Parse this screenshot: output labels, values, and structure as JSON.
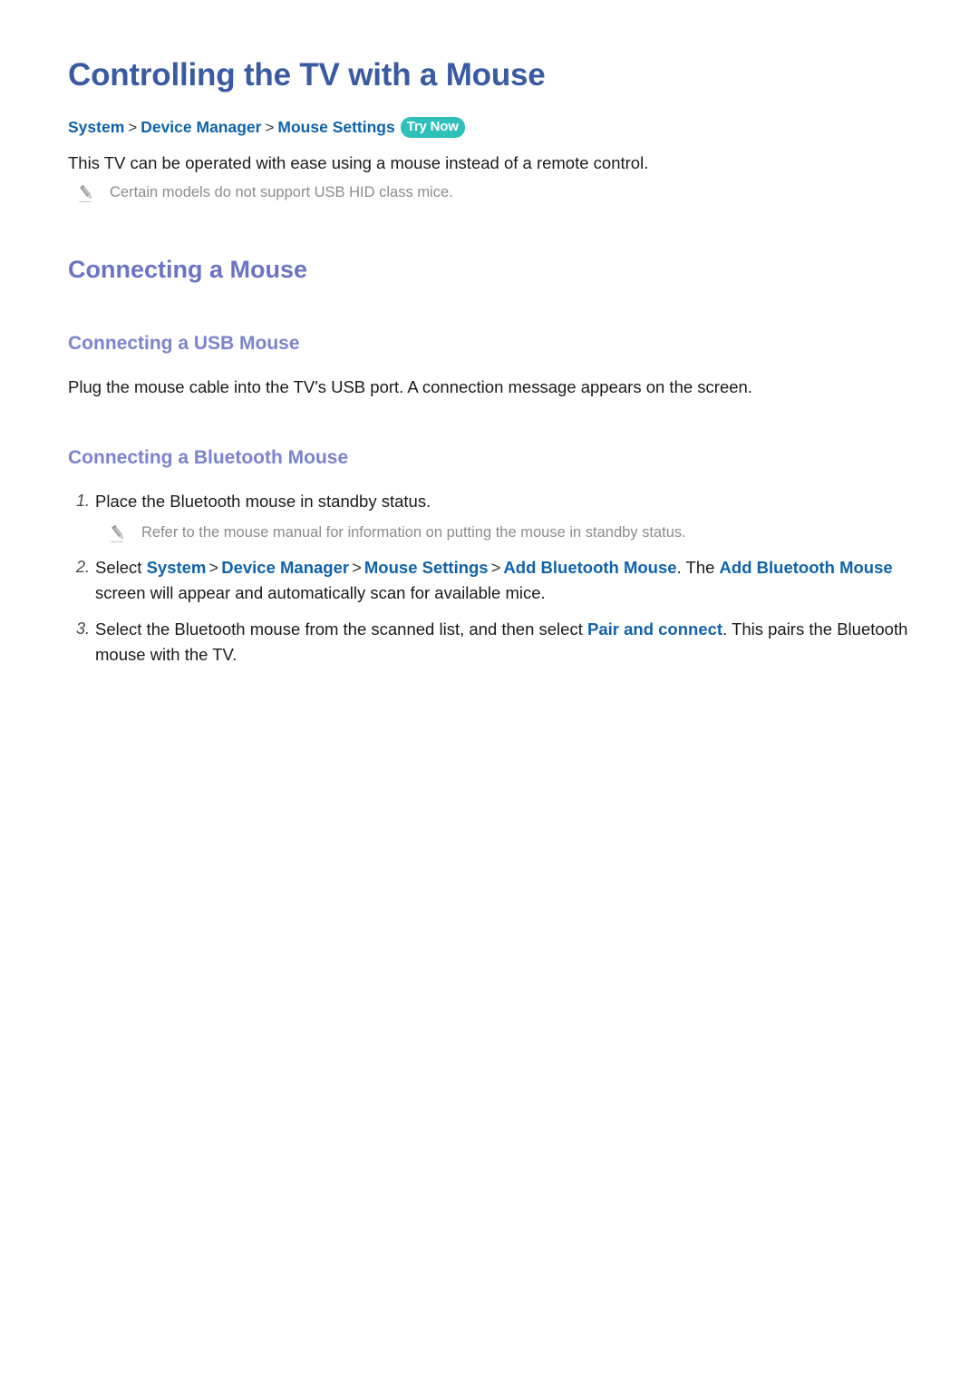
{
  "document": {
    "title": "Controlling the TV with a Mouse",
    "breadcrumb": {
      "items": [
        "System",
        "Device Manager",
        "Mouse Settings"
      ],
      "separator": ">",
      "badge": "Try Now"
    },
    "intro": "This TV can be operated with ease using a mouse instead of a remote control.",
    "intro_note": "Certain models do not support USB HID class mice.",
    "sections": [
      {
        "heading": "Connecting a Mouse",
        "subsections": [
          {
            "heading": "Connecting a USB Mouse",
            "paragraph": "Plug the mouse cable into the TV's USB port. A connection message appears on the screen."
          },
          {
            "heading": "Connecting a Bluetooth Mouse",
            "steps": [
              {
                "number": "1.",
                "parts": [
                  {
                    "kind": "text",
                    "text": "Place the Bluetooth mouse in standby status."
                  }
                ],
                "note": "Refer to the mouse manual for information on putting the mouse in standby status."
              },
              {
                "number": "2.",
                "parts": [
                  {
                    "kind": "text",
                    "text": "Select "
                  },
                  {
                    "kind": "link",
                    "text": "System"
                  },
                  {
                    "kind": "sep",
                    "text": ">"
                  },
                  {
                    "kind": "link",
                    "text": "Device Manager"
                  },
                  {
                    "kind": "sep",
                    "text": ">"
                  },
                  {
                    "kind": "link",
                    "text": "Mouse Settings"
                  },
                  {
                    "kind": "sep",
                    "text": ">"
                  },
                  {
                    "kind": "link",
                    "text": "Add Bluetooth Mouse"
                  },
                  {
                    "kind": "text",
                    "text": ". The "
                  },
                  {
                    "kind": "link",
                    "text": "Add Bluetooth Mouse"
                  },
                  {
                    "kind": "text",
                    "text": " screen will appear and automatically scan for available mice."
                  }
                ]
              },
              {
                "number": "3.",
                "parts": [
                  {
                    "kind": "text",
                    "text": "Select the Bluetooth mouse from the scanned list, and then select "
                  },
                  {
                    "kind": "link",
                    "text": "Pair and connect"
                  },
                  {
                    "kind": "text",
                    "text": ". This pairs the Bluetooth mouse with the TV."
                  }
                ]
              }
            ]
          }
        ]
      }
    ]
  },
  "colors": {
    "title": "#3a5ba2",
    "heading2": "#6b73c6",
    "heading3": "#7c83ce",
    "link": "#0f62ab",
    "badge_bg": "#2ec0b9",
    "badge_text": "#ffffff",
    "note_text": "#8c8c8c",
    "body_text": "#1a1a1a",
    "page_bg": "#ffffff"
  },
  "icons": {
    "note": "pencil-icon"
  }
}
